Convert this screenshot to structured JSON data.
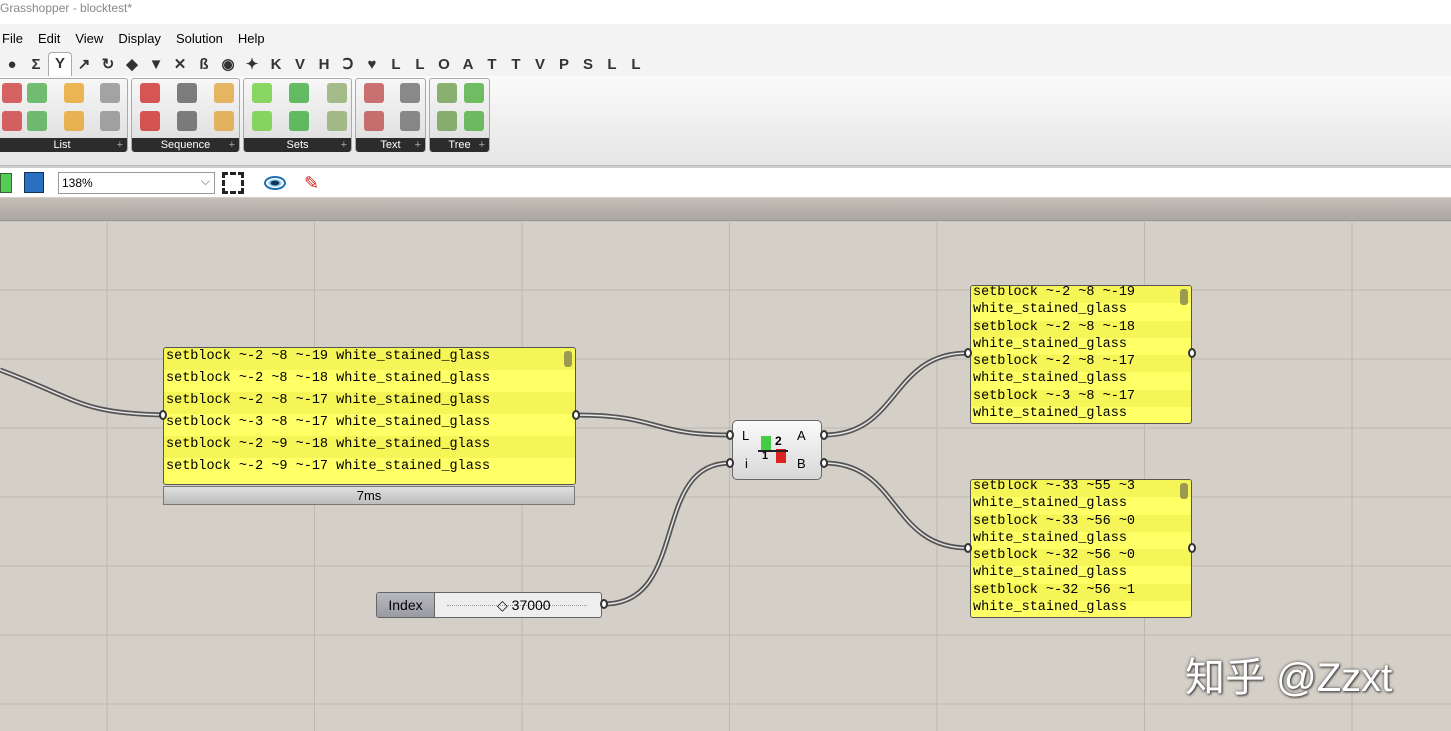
{
  "window": {
    "title": "Grasshopper - blocktest*"
  },
  "menu": [
    "File",
    "Edit",
    "View",
    "Display",
    "Solution",
    "Help"
  ],
  "tabs": [
    "●",
    "Σ",
    "Y",
    "↗",
    "↻",
    "◆",
    "▼",
    "✕",
    "ß",
    "◉",
    "✦",
    "K",
    "V",
    "H",
    "Ↄ",
    "♥",
    "L",
    "L",
    "O",
    "A",
    "T",
    "T",
    "V",
    "P",
    "S",
    "L",
    "L"
  ],
  "ribbon_groups": [
    "List",
    "Sequence",
    "Sets",
    "Text",
    "Tree"
  ],
  "toolbar": {
    "zoom": "138%"
  },
  "panel_main": {
    "rows": [
      "setblock ~-2 ~8 ~-19 white_stained_glass",
      "setblock ~-2 ~8 ~-18 white_stained_glass",
      "setblock ~-2 ~8 ~-17 white_stained_glass",
      "setblock ~-3 ~8 ~-17 white_stained_glass",
      "setblock ~-2 ~9 ~-18 white_stained_glass",
      "setblock ~-2 ~9 ~-17 white_stained_glass"
    ],
    "caption": "7ms"
  },
  "component": {
    "inputs": [
      "L",
      "i"
    ],
    "outputs": [
      "A",
      "B"
    ],
    "icon_top": "2",
    "icon_bottom": "1"
  },
  "slider": {
    "name": "Index",
    "value": "◇ 37000"
  },
  "panel_a": {
    "rows": [
      "setblock ~-2 ~8 ~-19",
      "white_stained_glass",
      "setblock ~-2 ~8 ~-18",
      "white_stained_glass",
      "setblock ~-2 ~8 ~-17",
      "white_stained_glass",
      "setblock ~-3 ~8 ~-17",
      "white_stained_glass"
    ]
  },
  "panel_b": {
    "rows": [
      "setblock ~-33 ~55 ~3",
      "white_stained_glass",
      "setblock ~-33 ~56 ~0",
      "white_stained_glass",
      "setblock ~-32 ~56 ~0",
      "white_stained_glass",
      "setblock ~-32 ~56 ~1",
      "white_stained_glass"
    ]
  },
  "watermark": "知乎 @Zzxt",
  "colors": {
    "panel": "#ffff66",
    "canvas": "#d4d0c8"
  }
}
